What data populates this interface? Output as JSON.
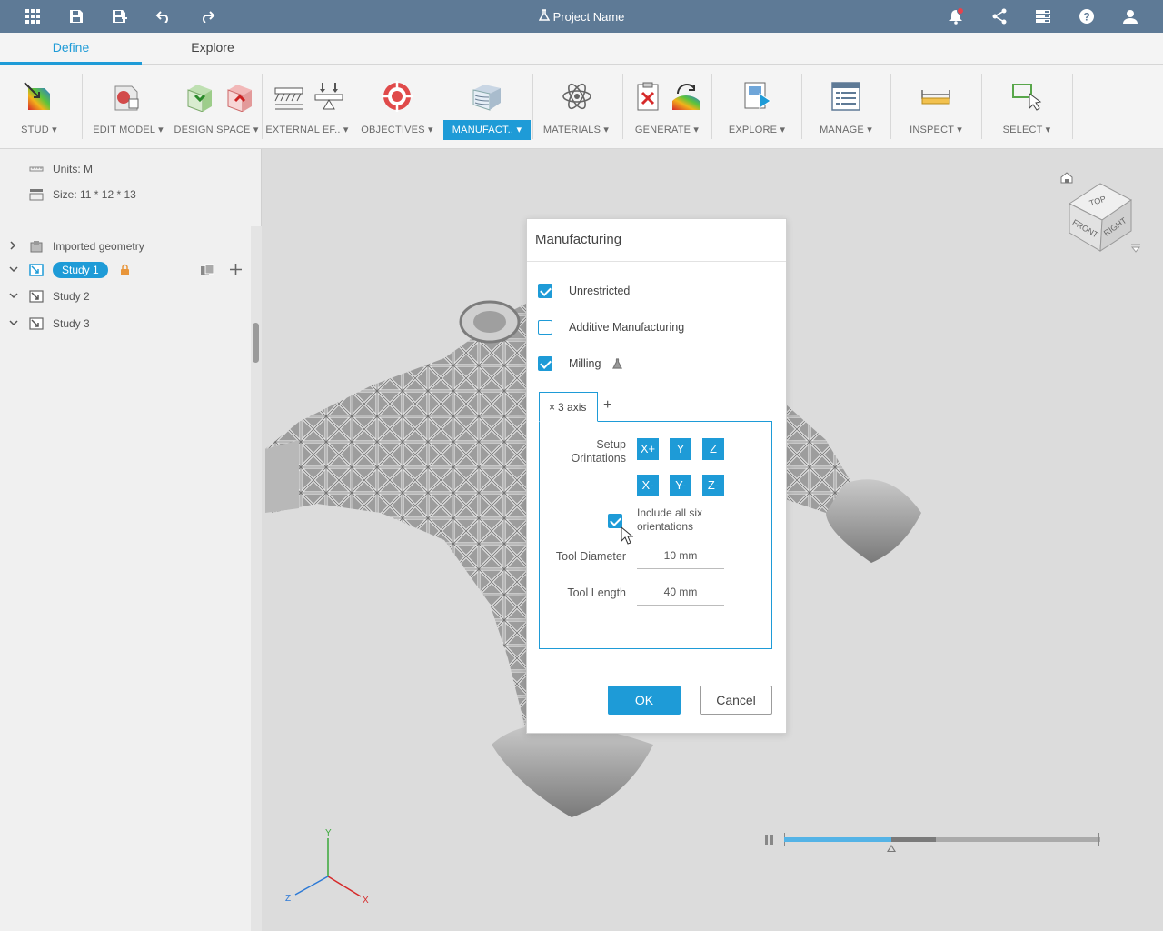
{
  "titlebar": {
    "project_name": "Project Name",
    "icons": [
      "apps-grid-icon",
      "save-icon",
      "save-as-icon",
      "undo-icon",
      "redo-icon",
      "notifications-icon",
      "share-icon",
      "job-status-icon",
      "help-icon",
      "account-icon"
    ],
    "notification_color": "#e8424c"
  },
  "tabs": [
    {
      "label": "Define",
      "active": true
    },
    {
      "label": "Explore",
      "active": false
    }
  ],
  "toolbar": {
    "groups": [
      {
        "label": "STUD",
        "icon": "study-icon"
      },
      {
        "label": "EDIT MODEL",
        "icon": "edit-model-icon"
      },
      {
        "label": "DESIGN SPACE",
        "icon": "design-space-icon"
      },
      {
        "label": "EXTERNAL EF..",
        "icon": "external-effects-icon"
      },
      {
        "label": "OBJECTIVES",
        "icon": "objectives-icon"
      },
      {
        "label": "MANUFACT..",
        "icon": "manufacturing-icon",
        "active": true
      },
      {
        "label": "MATERIALS",
        "icon": "materials-icon"
      },
      {
        "label": "GENERATE",
        "icon": "generate-icon"
      },
      {
        "label": "EXPLORE",
        "icon": "explore-icon"
      },
      {
        "label": "MANAGE",
        "icon": "manage-icon"
      },
      {
        "label": "INSPECT",
        "icon": "inspect-icon"
      },
      {
        "label": "SELECT",
        "icon": "select-icon"
      }
    ],
    "accent": "#1e9bd7"
  },
  "sidebar": {
    "units": "Units: M",
    "size": "Size: 11 * 12 * 13",
    "tree": [
      {
        "label": "Imported geometry",
        "icon": "imported-geometry-icon",
        "expanded": false
      },
      {
        "label": "Study 1",
        "icon": "study-icon",
        "expanded": true,
        "selected": true,
        "locked": true
      },
      {
        "label": "Study 2",
        "icon": "study-icon",
        "expanded": true
      },
      {
        "label": "Study 3",
        "icon": "study-icon",
        "expanded": true
      }
    ]
  },
  "dialog": {
    "title": "Manufacturing",
    "options": [
      {
        "label": "Unrestricted",
        "checked": true
      },
      {
        "label": "Additive Manufacturing",
        "checked": false
      },
      {
        "label": "Milling",
        "checked": true,
        "icon": "flask-icon"
      }
    ],
    "subtab": {
      "close": "×",
      "label": "3 axis",
      "add": "+"
    },
    "setup_label_line1": "Setup",
    "setup_label_line2": "Orintations",
    "orientations": [
      "X+",
      "Y",
      "Z",
      "X-",
      "Y-",
      "Z-"
    ],
    "include_all_line1": "Include all six",
    "include_all_line2": "orientations",
    "include_all_checked": true,
    "tool_diameter_label": "Tool Diameter",
    "tool_diameter_value": "10 mm",
    "tool_length_label": "Tool Length",
    "tool_length_value": "40 mm",
    "ok_label": "OK",
    "cancel_label": "Cancel"
  },
  "viewcube": {
    "top": "TOP",
    "front": "FRONT",
    "right": "RIGHT"
  },
  "axes": {
    "x": "X",
    "y": "Y",
    "z": "Z"
  },
  "playback": {
    "progress": 0.34,
    "buffered": 0.48
  }
}
